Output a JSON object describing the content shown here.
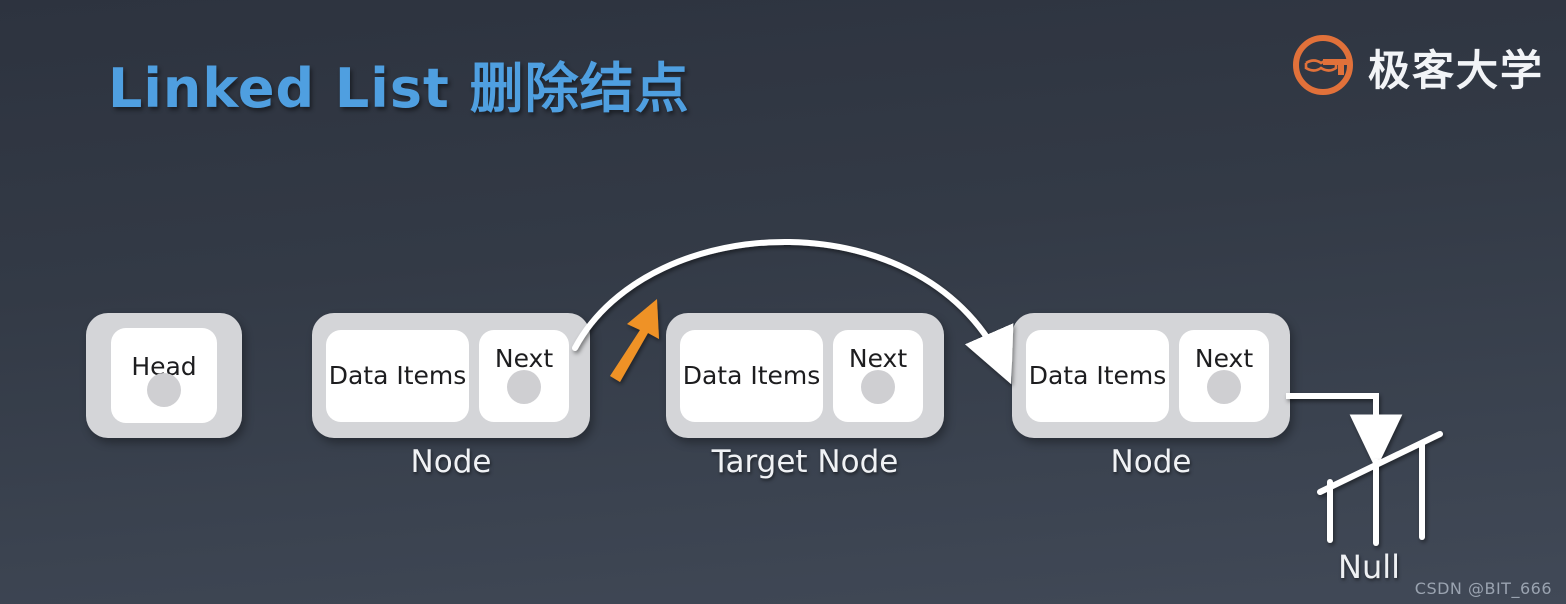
{
  "slide": {
    "title": "Linked List 删除结点",
    "title_color": "#4f9fe0",
    "background_top": "#2d333f",
    "background_bottom": "#414957",
    "watermark": "CSDN @BIT_666"
  },
  "logo": {
    "mark": "geekbang-g-icon",
    "mark_color": "#e1713a",
    "text": "极客大学"
  },
  "diagram": {
    "type": "linked-list-node-deletion",
    "head": {
      "label": "Head",
      "pointer": "pointer-dot"
    },
    "nodes": [
      {
        "caption": "Node",
        "data_label": "Data Items",
        "next_label": "Next"
      },
      {
        "caption": "Target Node",
        "data_label": "Data Items",
        "next_label": "Next"
      },
      {
        "caption": "Node",
        "data_label": "Data Items",
        "next_label": "Next"
      }
    ],
    "terminator": {
      "label": "Null",
      "symbol": "ground-null-icon"
    },
    "connectors": [
      {
        "name": "head-to-node1",
        "style": "solid",
        "color": "#ffffff"
      },
      {
        "name": "node1-to-target",
        "style": "dotted",
        "color": "#ffffff"
      },
      {
        "name": "target-to-node3",
        "style": "dotted",
        "color": "#ffffff"
      },
      {
        "name": "node1-bypass-to-node3",
        "style": "curved-solid",
        "color": "#ffffff"
      },
      {
        "name": "node3-to-null",
        "style": "elbow-solid",
        "color": "#ffffff"
      }
    ],
    "highlight_arrow": {
      "name": "orange-emphasis-arrow",
      "color": "#ef9226",
      "direction": "up-right"
    }
  }
}
